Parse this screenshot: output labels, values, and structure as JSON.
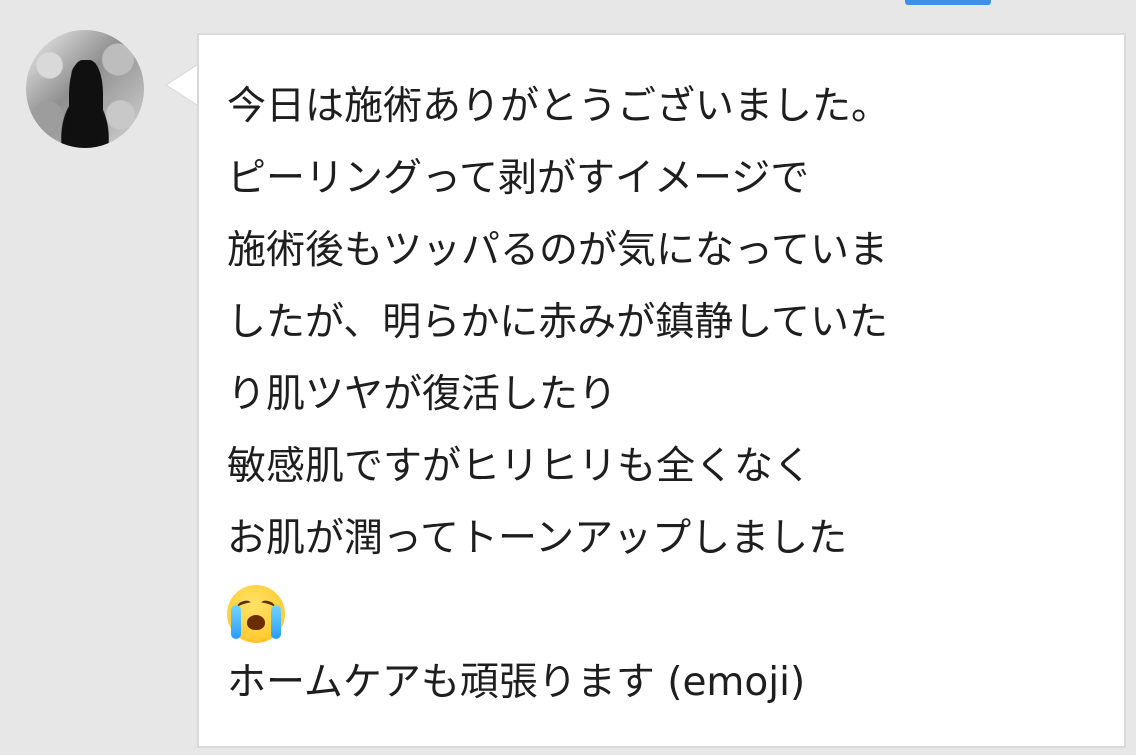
{
  "message": {
    "lines": [
      "今日は施術ありがとうございました。",
      "ピーリングって剥がすイメージで",
      "施術後もツッパるのが気になっていま",
      "したが、明らかに赤みが鎮静していた",
      "り肌ツヤが復活したり",
      "敏感肌ですがヒリヒリも全くなく",
      "お肌が潤ってトーンアップしました",
      "ホームケアも頑張ります (emoji)"
    ],
    "emoji_icon": "crying-face"
  },
  "colors": {
    "background": "#e7e7e7",
    "bubble": "#ffffff",
    "text": "#1e1e1e",
    "accent": "#3d8ee6"
  }
}
